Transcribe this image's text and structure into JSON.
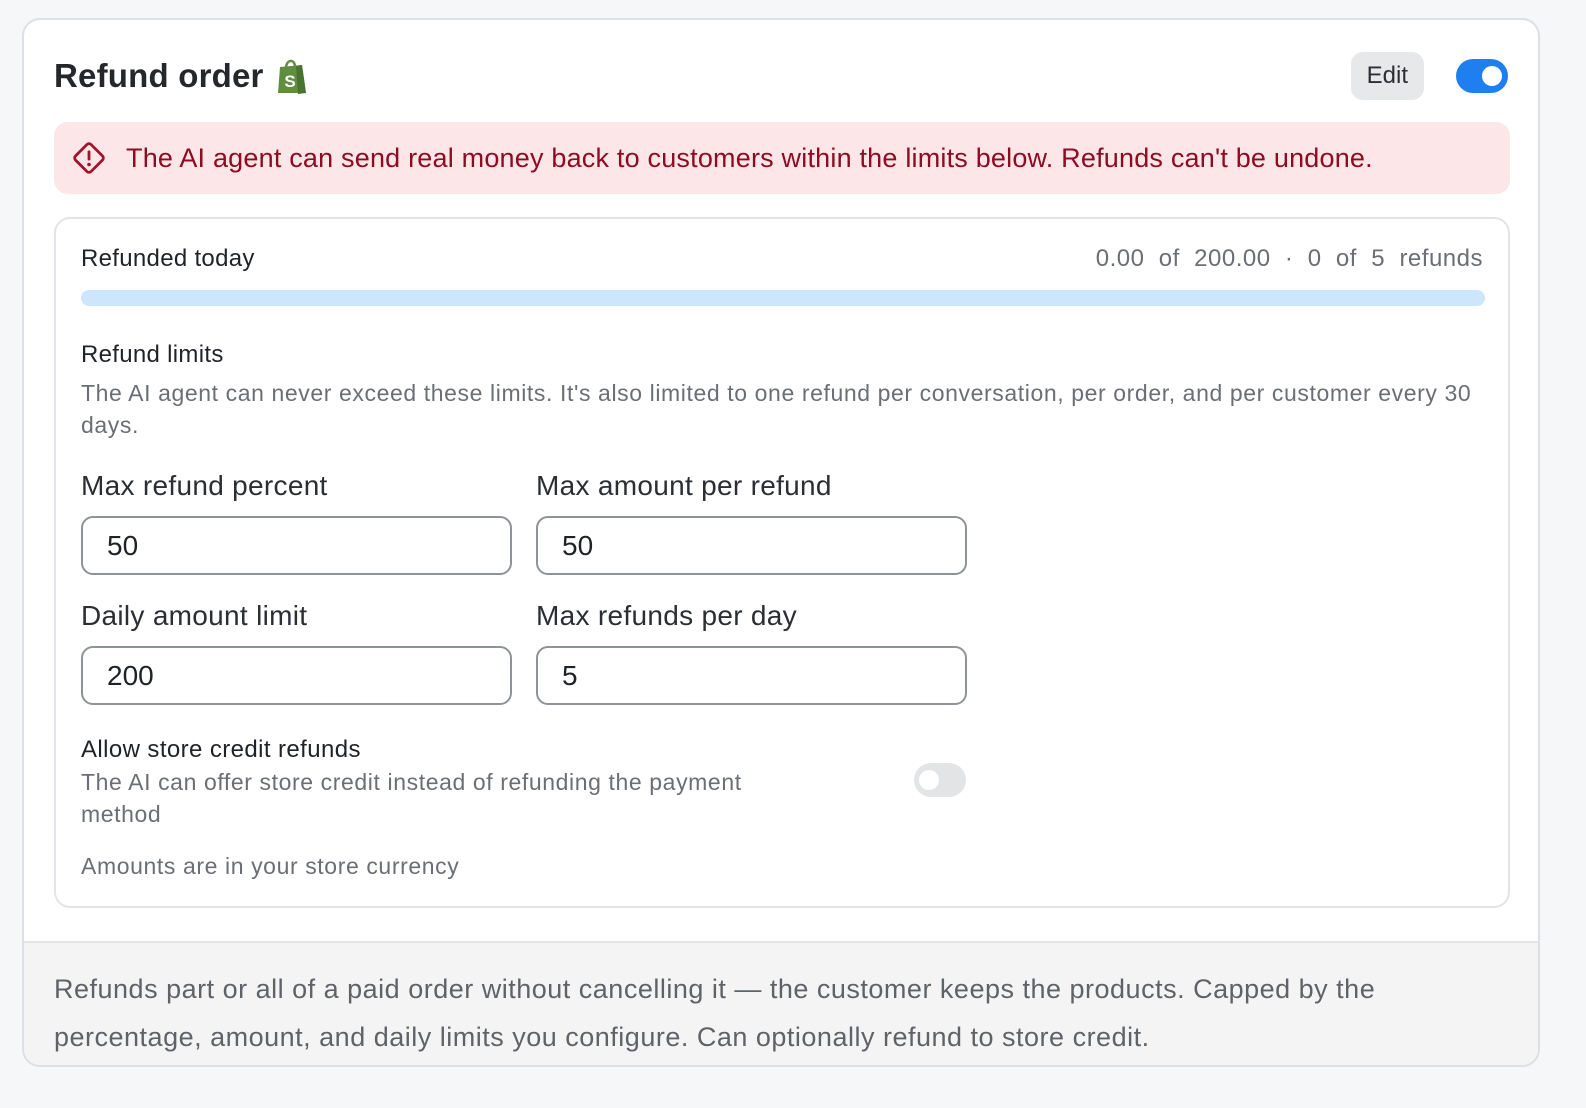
{
  "header": {
    "title": "Refund order",
    "edit_label": "Edit",
    "enabled": true
  },
  "icons": {
    "shop": "shopify-bag-icon",
    "alert": "alert-diamond-icon"
  },
  "colors": {
    "accent": "#1e7ff0",
    "alert_bg": "#fde6e8",
    "alert_text": "#8e0b21",
    "progress_track": "#cce6fb",
    "shop_green": "#5e8e3e"
  },
  "alert": {
    "text": "The AI agent can send real money back to customers within the limits below. Refunds can't be undone."
  },
  "usage": {
    "label": "Refunded today",
    "summary": "0.00  of  200.00  ·  0  of  5  refunds",
    "progress_fraction": 0.0
  },
  "limits": {
    "title": "Refund limits",
    "description": "The AI agent can never exceed these limits. It's also limited to one refund per conversation, per order, and per customer every 30 days.",
    "fields": [
      {
        "label": "Max refund percent",
        "value": "50"
      },
      {
        "label": "Max amount per refund",
        "value": "50"
      },
      {
        "label": "Daily amount limit",
        "value": "200"
      },
      {
        "label": "Max refunds per day",
        "value": "5"
      }
    ]
  },
  "store_credit": {
    "title": "Allow store credit refunds",
    "description": "The AI can offer store credit instead of refunding the payment method",
    "enabled": false
  },
  "currency_note": "Amounts are in your store currency",
  "footer": {
    "text": "Refunds part or all of a paid order without cancelling it — the customer keeps the products. Capped by the percentage, amount, and daily limits you configure. Can optionally refund to store credit."
  }
}
